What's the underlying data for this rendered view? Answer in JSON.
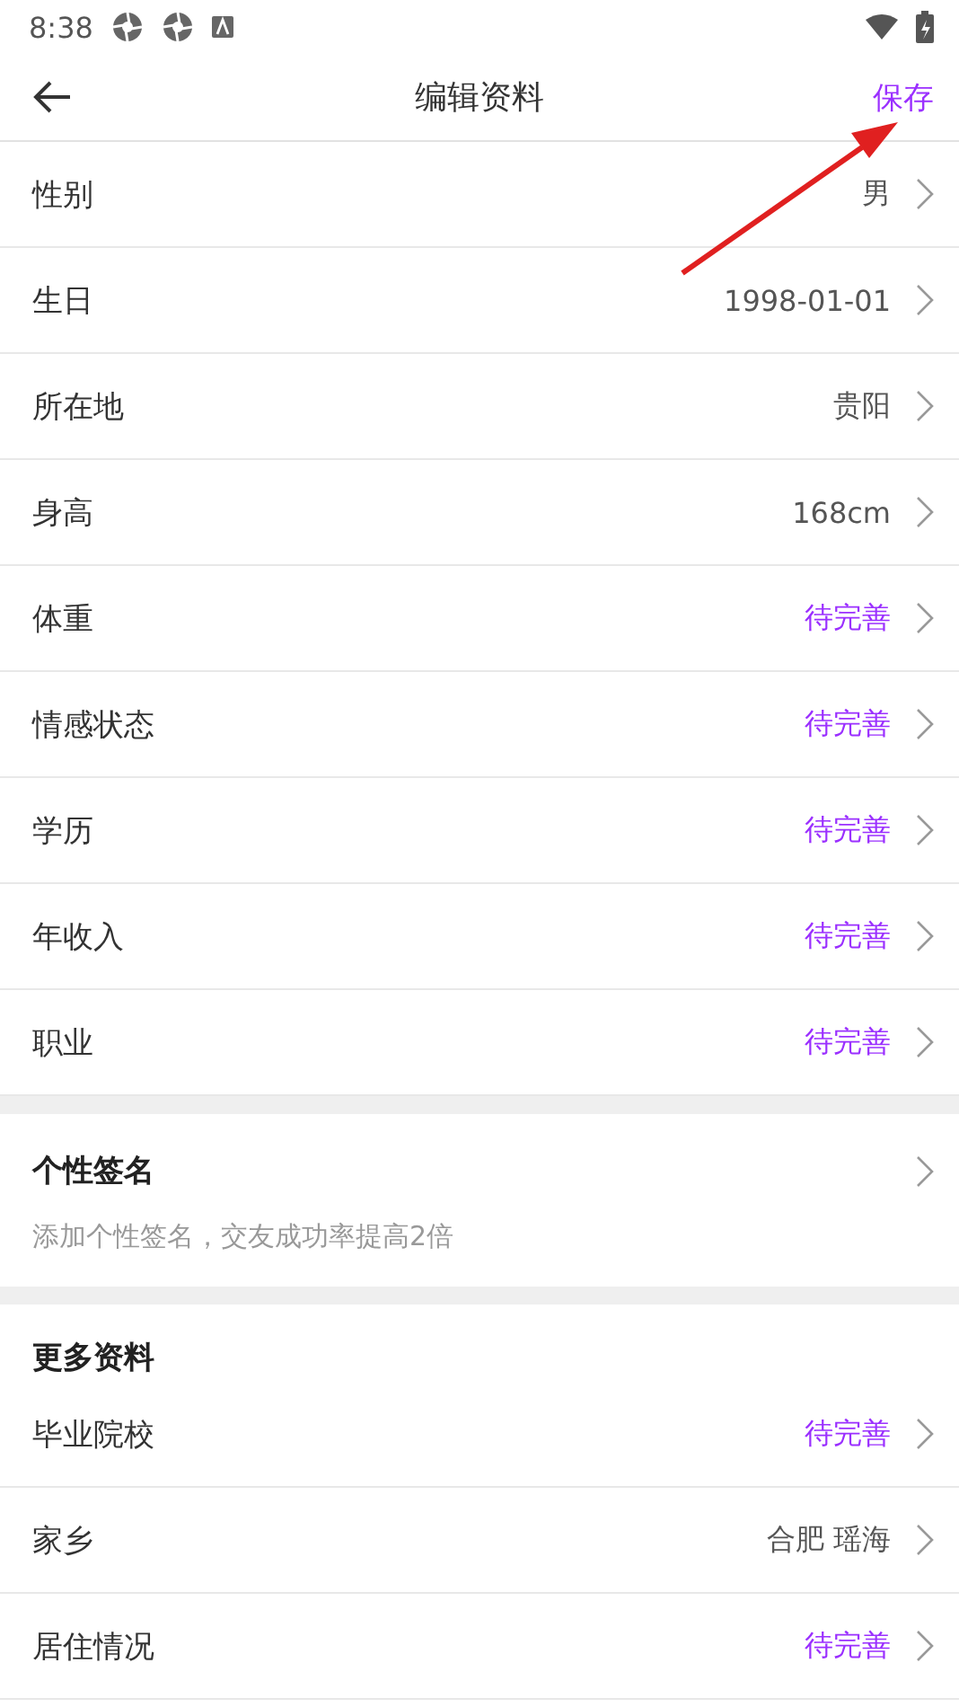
{
  "status_bar": {
    "time": "8:38"
  },
  "header": {
    "title": "编辑资料",
    "action": "保存"
  },
  "basic_rows": [
    {
      "label": "性别",
      "value": "男",
      "pending": false
    },
    {
      "label": "生日",
      "value": "1998-01-01",
      "pending": false
    },
    {
      "label": "所在地",
      "value": "贵阳",
      "pending": false
    },
    {
      "label": "身高",
      "value": "168cm",
      "pending": false
    },
    {
      "label": "体重",
      "value": "待完善",
      "pending": true
    },
    {
      "label": "情感状态",
      "value": "待完善",
      "pending": true
    },
    {
      "label": "学历",
      "value": "待完善",
      "pending": true
    },
    {
      "label": "年收入",
      "value": "待完善",
      "pending": true
    },
    {
      "label": "职业",
      "value": "待完善",
      "pending": true
    }
  ],
  "signature": {
    "title": "个性签名",
    "hint": "添加个性签名，交友成功率提高2倍"
  },
  "more": {
    "title": "更多资料",
    "rows": [
      {
        "label": "毕业院校",
        "value": "待完善",
        "pending": true
      },
      {
        "label": "家乡",
        "value": "合肥 瑶海",
        "pending": false
      },
      {
        "label": "居住情况",
        "value": "待完善",
        "pending": true
      }
    ]
  }
}
